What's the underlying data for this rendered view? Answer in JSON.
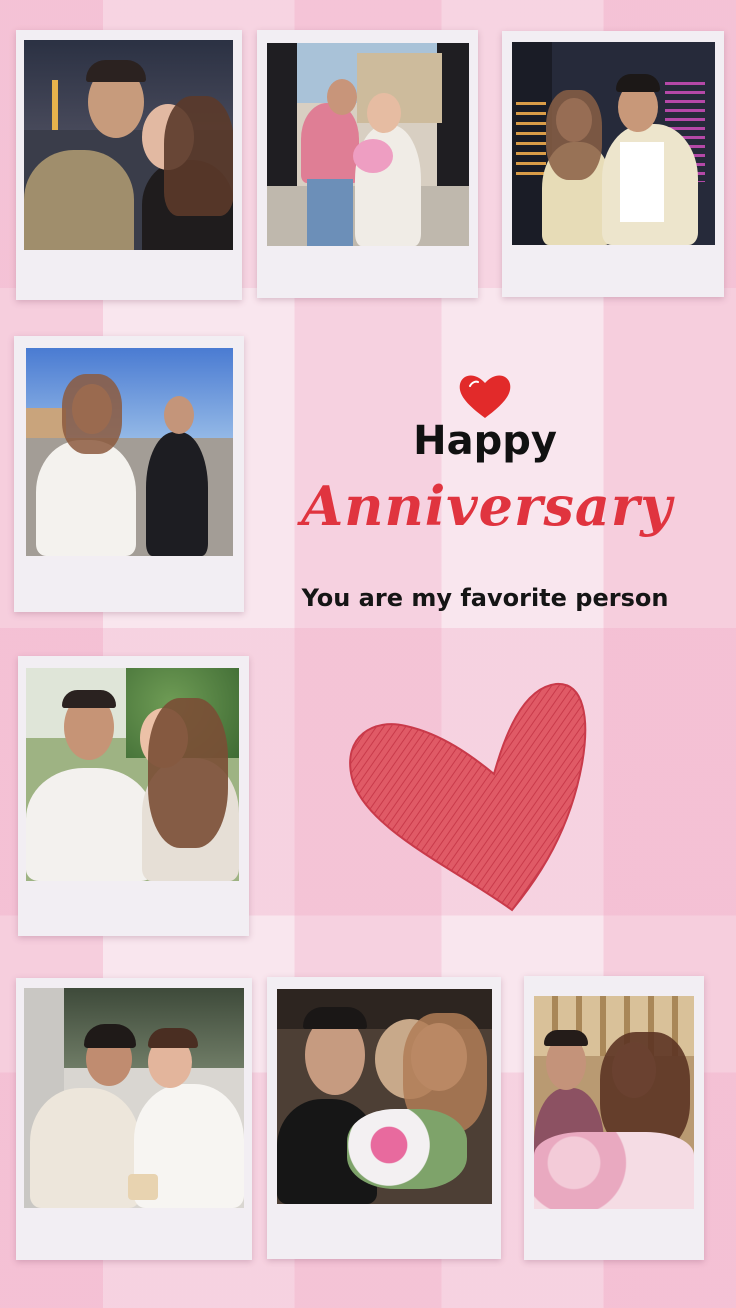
{
  "card": {
    "greeting_line1": "Happy",
    "greeting_line2": "Anniversary",
    "tagline": "You are my favorite person"
  },
  "colors": {
    "accent_red": "#e0343f",
    "text_dark": "#111111",
    "polaroid_frame": "#f2eef3",
    "background_pink": "#f9e6ee"
  },
  "icons": [
    "small-heart-icon",
    "scribble-heart-icon"
  ]
}
